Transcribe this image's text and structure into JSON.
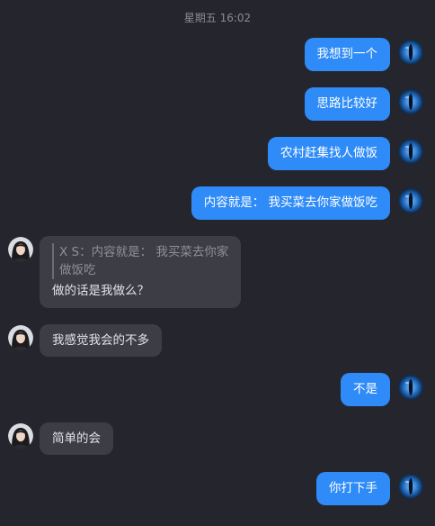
{
  "timestamp": "星期五 16:02",
  "messages": [
    {
      "dir": "out",
      "text": "我想到一个"
    },
    {
      "dir": "out",
      "text": "思路比较好"
    },
    {
      "dir": "out",
      "text": "农村赶集找人做饭"
    },
    {
      "dir": "out",
      "text": "内容就是： 我买菜去你家做饭吃"
    },
    {
      "dir": "in",
      "quote_line1": "X  S：内容就是： 我买菜去你家",
      "quote_line2": "做饭吃",
      "text": "做的话是我做么？"
    },
    {
      "dir": "in",
      "text": "我感觉我会的不多"
    },
    {
      "dir": "out",
      "text": "不是"
    },
    {
      "dir": "in",
      "text": "简单的会"
    },
    {
      "dir": "out",
      "text": "你打下手"
    }
  ],
  "colors": {
    "background": "#25262d",
    "outgoing_bubble": "#2e8bf7",
    "incoming_bubble": "#3c3d45"
  },
  "icons": {
    "self_avatar": "blue-eye-avatar-icon",
    "contact_avatar": "woman-portrait-avatar-icon"
  }
}
